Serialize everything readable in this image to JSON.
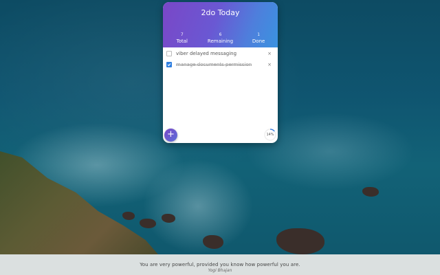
{
  "app": {
    "title": "2do Today",
    "stats": [
      {
        "count": "7",
        "label": "Total"
      },
      {
        "count": "6",
        "label": "Remaining"
      },
      {
        "count": "1",
        "label": "Done"
      }
    ],
    "tasks": [
      {
        "text": "viber delayed messaging",
        "done": false
      },
      {
        "text": "manage documents permission",
        "done": true
      }
    ],
    "delete_icon": "×",
    "add_icon": "+",
    "progress_text": "14%",
    "progress_fraction": 0.14
  },
  "footer": {
    "quote": "You are very powerful, provided you know how powerful you are.",
    "author": "Yogi Bhajan"
  },
  "colors": {
    "accent_purple": "#7a47c7",
    "accent_blue": "#3a93e0",
    "checkbox_blue": "#2f7fe0"
  }
}
